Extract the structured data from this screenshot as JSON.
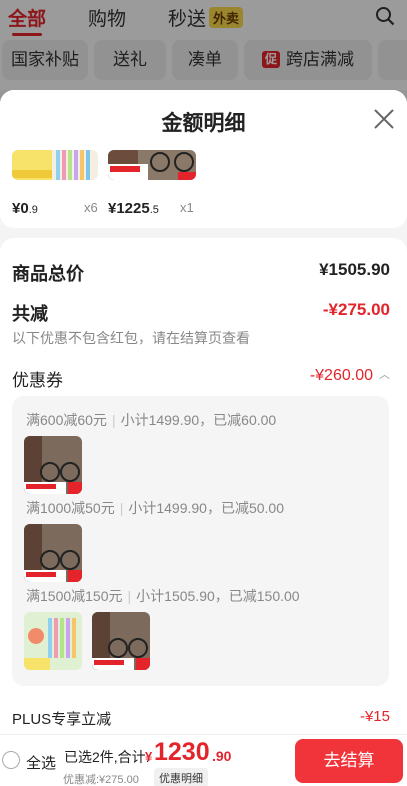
{
  "nav": {
    "tabs": [
      "全部",
      "购物",
      "秒送"
    ],
    "waimai_badge": "外卖",
    "chips": [
      "国家补贴",
      "送礼",
      "凑单",
      "跨店满减"
    ],
    "chip_cu": "促"
  },
  "sheet": {
    "title": "金额明细",
    "items": [
      {
        "price_int": "¥0",
        "price_dec": ".9",
        "qty": "x6"
      },
      {
        "price_int": "¥1225",
        "price_dec": ".5",
        "qty": "x1"
      }
    ],
    "total_label": "商品总价",
    "total_value": "¥1505.90",
    "reduce_label": "共减",
    "reduce_value": "-¥275.00",
    "reduce_note": "以下优惠不包含红包，请在结算页查看",
    "coupon_label": "优惠券",
    "coupon_value": "-¥260.00",
    "coupons": [
      {
        "rule": "满600减60元",
        "detail": "小计1499.90，已减60.00"
      },
      {
        "rule": "满1000减50元",
        "detail": "小计1499.90，已减50.00"
      },
      {
        "rule": "满1500减150元",
        "detail": "小计1505.90，已减150.00"
      }
    ],
    "plus_label": "PLUS专享立减",
    "plus_value": "-¥15"
  },
  "bottom": {
    "select_all": "全选",
    "selected": "已选2件,合计:",
    "currency": "¥",
    "total_int": "1230",
    "total_dec": ".90",
    "discount_note": "优惠减:¥275.00",
    "detail_btn": "优惠明细",
    "checkout": "去结算"
  },
  "colors": {
    "accent": "#e3242b",
    "checkout": "#f1343a"
  }
}
